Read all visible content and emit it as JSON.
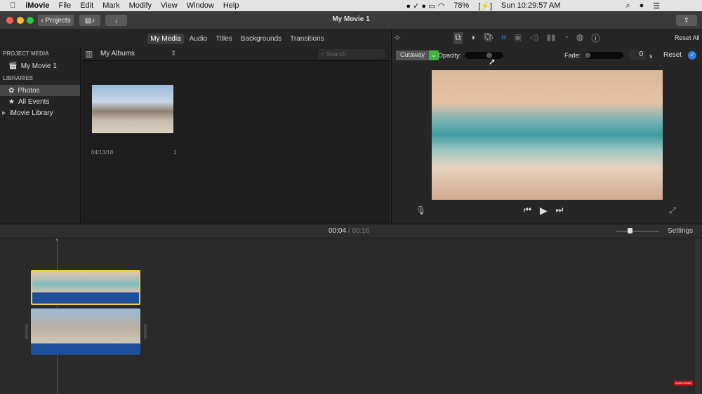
{
  "menubar": {
    "app": "iMovie",
    "items": [
      "File",
      "Edit",
      "Mark",
      "Modify",
      "View",
      "Window",
      "Help"
    ],
    "battery": "78%",
    "clock": "Sun 10:29:57 AM"
  },
  "titlebar": {
    "title": "My Movie 1",
    "projects_button": "Projects"
  },
  "tabs": [
    "My Media",
    "Audio",
    "Titles",
    "Backgrounds",
    "Transitions"
  ],
  "sidebar": {
    "project_media_header": "PROJECT MEDIA",
    "project": "My Movie 1",
    "libraries_header": "LIBRARIES",
    "items": [
      "Photos",
      "All Events",
      "iMovie Library"
    ]
  },
  "browser": {
    "album_select": "My Albums",
    "search_placeholder": "Search",
    "item": {
      "date": "04/13/18",
      "count": "1"
    }
  },
  "inspector": {
    "reset_all": "Reset All",
    "overlay_mode": "Cutaway",
    "opacity_label": "Opacity:",
    "opacity_value": 0.65,
    "fade_label": "Fade:",
    "fade_value": "0",
    "fade_unit": "s",
    "reset": "Reset"
  },
  "timeline": {
    "current": "00:04",
    "separator": "/",
    "total": "00:16",
    "settings": "Settings",
    "zoom_level": 0.3
  },
  "watermark": "SUBSCRIBE"
}
